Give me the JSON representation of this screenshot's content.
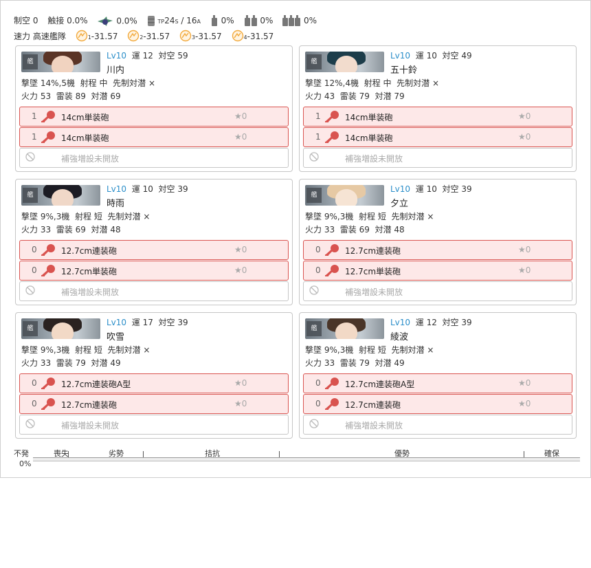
{
  "summary": {
    "row1": {
      "air_label": "制空",
      "air_value": "0",
      "contact_label": "触接",
      "contact_value": "0.0%",
      "plane_value": "0.0%",
      "tp_prefix": "TP",
      "tp_s": "24",
      "tp_s_sub": "S",
      "tp_sep": " / 16",
      "tp_a_sub": "A",
      "drum1_value": "0%",
      "drum2_value": "0%",
      "drum3_value": "0%"
    },
    "row2": {
      "speed_label": "速力",
      "speed_value": "高速艦隊",
      "los": [
        {
          "sub": "1",
          "value": "-31.57"
        },
        {
          "sub": "2",
          "value": "-31.57"
        },
        {
          "sub": "3",
          "value": "-31.57"
        },
        {
          "sub": "4",
          "value": "-31.57"
        }
      ]
    }
  },
  "labels": {
    "luck": "運",
    "aa": "対空",
    "evasion": "撃墜",
    "range": "射程",
    "oasw": "先制対潜",
    "firepower": "火力",
    "torpedo": "雷装",
    "asw": "対潜",
    "lv": "Lv",
    "star": "★0",
    "reinforce": "補強増設未開放"
  },
  "ships": [
    {
      "name": "川内",
      "lv": "10",
      "luck": "12",
      "aa": "59",
      "shotdown": "14%,5機",
      "range": "中",
      "oasw": "×",
      "fp": "53",
      "tp": "89",
      "asw": "69",
      "hair": "#5a3426",
      "face": "#f1d3c0",
      "slots": [
        {
          "count": "1",
          "name": "14cm単装砲",
          "star": "★0"
        },
        {
          "count": "1",
          "name": "14cm単装砲",
          "star": "★0"
        }
      ]
    },
    {
      "name": "五十鈴",
      "lv": "10",
      "luck": "10",
      "aa": "49",
      "shotdown": "12%,4機",
      "range": "中",
      "oasw": "×",
      "fp": "43",
      "tp": "79",
      "asw": "79",
      "hair": "#1d3d4a",
      "face": "#f2dccd",
      "slots": [
        {
          "count": "1",
          "name": "14cm単装砲",
          "star": "★0"
        },
        {
          "count": "1",
          "name": "14cm単装砲",
          "star": "★0"
        }
      ]
    },
    {
      "name": "時雨",
      "lv": "10",
      "luck": "10",
      "aa": "39",
      "shotdown": "9%,3機",
      "range": "短",
      "oasw": "×",
      "fp": "33",
      "tp": "69",
      "asw": "48",
      "hair": "#1c1c24",
      "face": "#f0d8c8",
      "slots": [
        {
          "count": "0",
          "name": "12.7cm連装砲",
          "star": "★0"
        },
        {
          "count": "0",
          "name": "12.7cm単装砲",
          "star": "★0"
        }
      ]
    },
    {
      "name": "夕立",
      "lv": "10",
      "luck": "10",
      "aa": "39",
      "shotdown": "9%,3機",
      "range": "短",
      "oasw": "×",
      "fp": "33",
      "tp": "69",
      "asw": "48",
      "hair": "#e6c9a4",
      "face": "#f6e4d4",
      "slots": [
        {
          "count": "0",
          "name": "12.7cm連装砲",
          "star": "★0"
        },
        {
          "count": "0",
          "name": "12.7cm単装砲",
          "star": "★0"
        }
      ]
    },
    {
      "name": "吹雪",
      "lv": "10",
      "luck": "17",
      "aa": "39",
      "shotdown": "9%,3機",
      "range": "短",
      "oasw": "×",
      "fp": "33",
      "tp": "79",
      "asw": "49",
      "hair": "#2a2220",
      "face": "#f2d9c6",
      "slots": [
        {
          "count": "0",
          "name": "12.7cm連装砲A型",
          "star": "★0"
        },
        {
          "count": "0",
          "name": "12.7cm連装砲",
          "star": "★0"
        }
      ]
    },
    {
      "name": "綾波",
      "lv": "10",
      "luck": "12",
      "aa": "39",
      "shotdown": "9%,3機",
      "range": "短",
      "oasw": "×",
      "fp": "33",
      "tp": "79",
      "asw": "49",
      "hair": "#4a3528",
      "face": "#f2d9c6",
      "slots": [
        {
          "count": "0",
          "name": "12.7cm連装砲A型",
          "star": "★0"
        },
        {
          "count": "0",
          "name": "12.7cm連装砲",
          "star": "★0"
        }
      ]
    }
  ],
  "gauge": {
    "left_top": "不発",
    "left_bottom": "0%",
    "labels": [
      "喪失",
      "劣勢",
      "拮抗",
      "優勢",
      "確保"
    ],
    "value_percent": 0
  },
  "colors": {
    "accent": "#2a8ec9",
    "slot_border": "#d9534f",
    "slot_bg": "#fde8e8",
    "gun_icon": "#d9534f",
    "los_icon": "#f2a93b"
  },
  "icons": [
    "plane-icon",
    "transport-barrel-icon",
    "drum-icon",
    "los-icon",
    "gun-icon",
    "ban-icon",
    "star-icon"
  ]
}
